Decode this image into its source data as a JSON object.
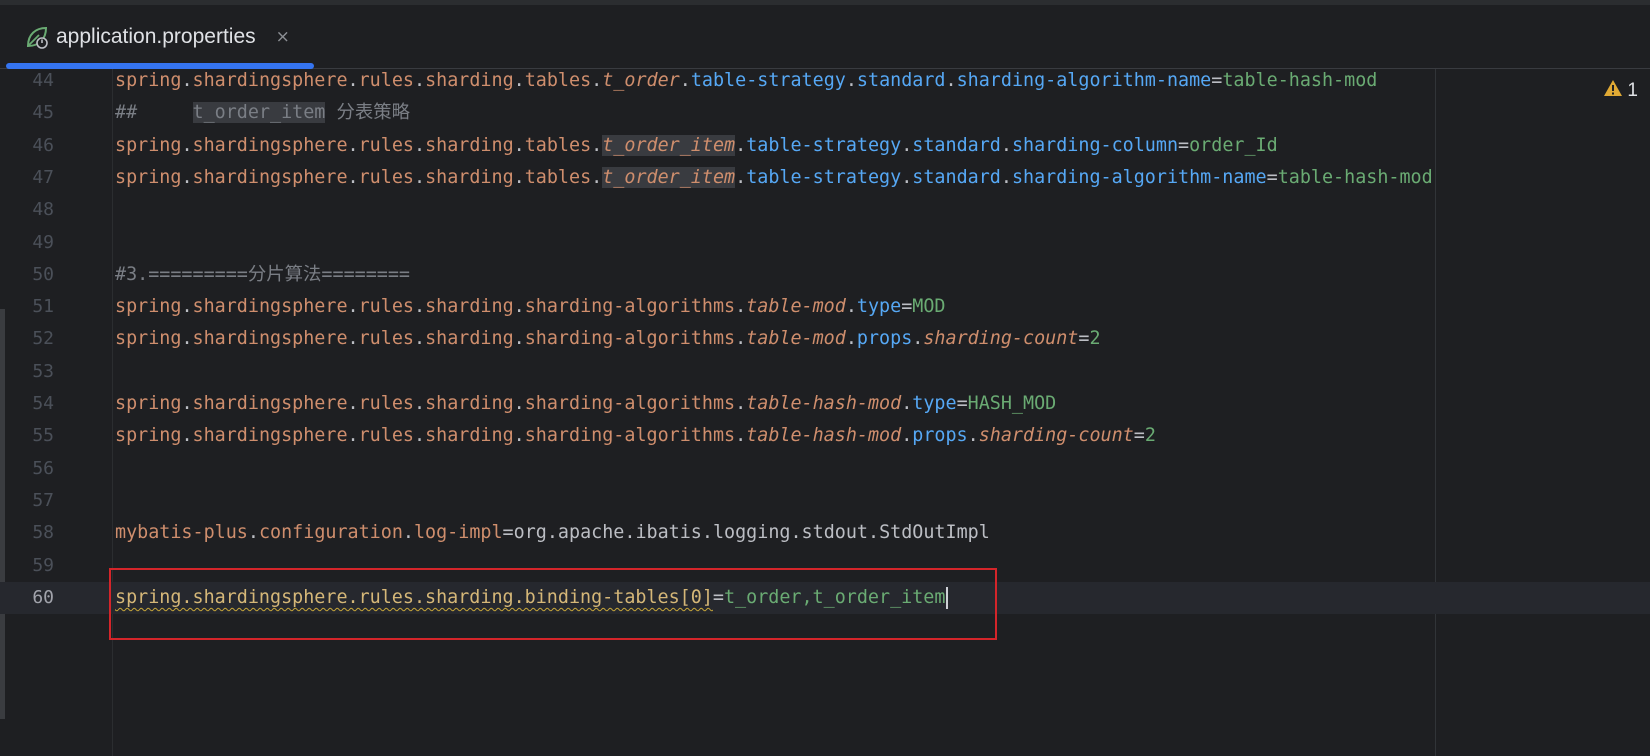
{
  "tab": {
    "label": "application.properties",
    "icon": "spring-leaf-icon",
    "close_label": "×"
  },
  "inspection": {
    "icon": "warning-triangle-icon",
    "count": "1"
  },
  "lines": [
    {
      "n": "44",
      "segs": [
        [
          "k",
          "spring"
        ],
        [
          "d",
          "."
        ],
        [
          "k",
          "shardingsphere"
        ],
        [
          "d",
          "."
        ],
        [
          "k",
          "rules"
        ],
        [
          "d",
          "."
        ],
        [
          "k",
          "sharding"
        ],
        [
          "d",
          "."
        ],
        [
          "k",
          "tables"
        ],
        [
          "d",
          "."
        ],
        [
          "ki",
          "t_order"
        ],
        [
          "d",
          "."
        ],
        [
          "kb",
          "table-strategy"
        ],
        [
          "d",
          "."
        ],
        [
          "kb",
          "standard"
        ],
        [
          "d",
          "."
        ],
        [
          "kb",
          "sharding-algorithm-name"
        ],
        [
          "e",
          "="
        ],
        [
          "v",
          "table-hash-mod"
        ]
      ]
    },
    {
      "n": "45",
      "segs": [
        [
          "c",
          "##     "
        ],
        [
          "ch",
          "t_order_item"
        ],
        [
          "c",
          " 分表策略"
        ]
      ]
    },
    {
      "n": "46",
      "segs": [
        [
          "k",
          "spring"
        ],
        [
          "d",
          "."
        ],
        [
          "k",
          "shardingsphere"
        ],
        [
          "d",
          "."
        ],
        [
          "k",
          "rules"
        ],
        [
          "d",
          "."
        ],
        [
          "k",
          "sharding"
        ],
        [
          "d",
          "."
        ],
        [
          "k",
          "tables"
        ],
        [
          "d",
          "."
        ],
        [
          "kih",
          "t_order_item"
        ],
        [
          "d",
          "."
        ],
        [
          "kb",
          "table-strategy"
        ],
        [
          "d",
          "."
        ],
        [
          "kb",
          "standard"
        ],
        [
          "d",
          "."
        ],
        [
          "kb",
          "sharding-column"
        ],
        [
          "e",
          "="
        ],
        [
          "v",
          "order_Id"
        ]
      ]
    },
    {
      "n": "47",
      "segs": [
        [
          "k",
          "spring"
        ],
        [
          "d",
          "."
        ],
        [
          "k",
          "shardingsphere"
        ],
        [
          "d",
          "."
        ],
        [
          "k",
          "rules"
        ],
        [
          "d",
          "."
        ],
        [
          "k",
          "sharding"
        ],
        [
          "d",
          "."
        ],
        [
          "k",
          "tables"
        ],
        [
          "d",
          "."
        ],
        [
          "kih",
          "t_order_item"
        ],
        [
          "d",
          "."
        ],
        [
          "kb",
          "table-strategy"
        ],
        [
          "d",
          "."
        ],
        [
          "kb",
          "standard"
        ],
        [
          "d",
          "."
        ],
        [
          "kb",
          "sharding-algorithm-name"
        ],
        [
          "e",
          "="
        ],
        [
          "v",
          "table-hash-mod"
        ]
      ]
    },
    {
      "n": "48",
      "segs": []
    },
    {
      "n": "49",
      "segs": []
    },
    {
      "n": "50",
      "segs": [
        [
          "c",
          "#3.=========分片算法========"
        ]
      ]
    },
    {
      "n": "51",
      "segs": [
        [
          "k",
          "spring"
        ],
        [
          "d",
          "."
        ],
        [
          "k",
          "shardingsphere"
        ],
        [
          "d",
          "."
        ],
        [
          "k",
          "rules"
        ],
        [
          "d",
          "."
        ],
        [
          "k",
          "sharding"
        ],
        [
          "d",
          "."
        ],
        [
          "k",
          "sharding-algorithms"
        ],
        [
          "d",
          "."
        ],
        [
          "ki",
          "table-mod"
        ],
        [
          "d",
          "."
        ],
        [
          "kb",
          "type"
        ],
        [
          "e",
          "="
        ],
        [
          "v",
          "MOD"
        ]
      ]
    },
    {
      "n": "52",
      "segs": [
        [
          "k",
          "spring"
        ],
        [
          "d",
          "."
        ],
        [
          "k",
          "shardingsphere"
        ],
        [
          "d",
          "."
        ],
        [
          "k",
          "rules"
        ],
        [
          "d",
          "."
        ],
        [
          "k",
          "sharding"
        ],
        [
          "d",
          "."
        ],
        [
          "k",
          "sharding-algorithms"
        ],
        [
          "d",
          "."
        ],
        [
          "ki",
          "table-mod"
        ],
        [
          "d",
          "."
        ],
        [
          "kb",
          "props"
        ],
        [
          "d",
          "."
        ],
        [
          "ki",
          "sharding-count"
        ],
        [
          "e",
          "="
        ],
        [
          "v",
          "2"
        ]
      ]
    },
    {
      "n": "53",
      "segs": []
    },
    {
      "n": "54",
      "segs": [
        [
          "k",
          "spring"
        ],
        [
          "d",
          "."
        ],
        [
          "k",
          "shardingsphere"
        ],
        [
          "d",
          "."
        ],
        [
          "k",
          "rules"
        ],
        [
          "d",
          "."
        ],
        [
          "k",
          "sharding"
        ],
        [
          "d",
          "."
        ],
        [
          "k",
          "sharding-algorithms"
        ],
        [
          "d",
          "."
        ],
        [
          "ki",
          "table-hash-mod"
        ],
        [
          "d",
          "."
        ],
        [
          "kb",
          "type"
        ],
        [
          "e",
          "="
        ],
        [
          "v",
          "HASH_MOD"
        ]
      ]
    },
    {
      "n": "55",
      "segs": [
        [
          "k",
          "spring"
        ],
        [
          "d",
          "."
        ],
        [
          "k",
          "shardingsphere"
        ],
        [
          "d",
          "."
        ],
        [
          "k",
          "rules"
        ],
        [
          "d",
          "."
        ],
        [
          "k",
          "sharding"
        ],
        [
          "d",
          "."
        ],
        [
          "k",
          "sharding-algorithms"
        ],
        [
          "d",
          "."
        ],
        [
          "ki",
          "table-hash-mod"
        ],
        [
          "d",
          "."
        ],
        [
          "kb",
          "props"
        ],
        [
          "d",
          "."
        ],
        [
          "ki",
          "sharding-count"
        ],
        [
          "e",
          "="
        ],
        [
          "v",
          "2"
        ]
      ]
    },
    {
      "n": "56",
      "segs": []
    },
    {
      "n": "57",
      "segs": []
    },
    {
      "n": "58",
      "segs": [
        [
          "k",
          "mybatis-plus"
        ],
        [
          "d",
          "."
        ],
        [
          "k",
          "configuration"
        ],
        [
          "d",
          "."
        ],
        [
          "k",
          "log-impl"
        ],
        [
          "e",
          "="
        ],
        [
          "p",
          "org"
        ],
        [
          "d",
          "."
        ],
        [
          "p",
          "apache"
        ],
        [
          "d",
          "."
        ],
        [
          "p",
          "ibatis"
        ],
        [
          "d",
          "."
        ],
        [
          "p",
          "logging"
        ],
        [
          "d",
          "."
        ],
        [
          "p",
          "stdout"
        ],
        [
          "d",
          "."
        ],
        [
          "p",
          "StdOutImpl"
        ]
      ]
    },
    {
      "n": "59",
      "segs": []
    },
    {
      "n": "60",
      "current": true,
      "caret": true,
      "segs": [
        [
          "ws",
          "spring.shardingsphere.rules.sharding.binding-tables[0]"
        ],
        [
          "e",
          "="
        ],
        [
          "v",
          "t_order,t_order_item"
        ]
      ]
    }
  ]
}
